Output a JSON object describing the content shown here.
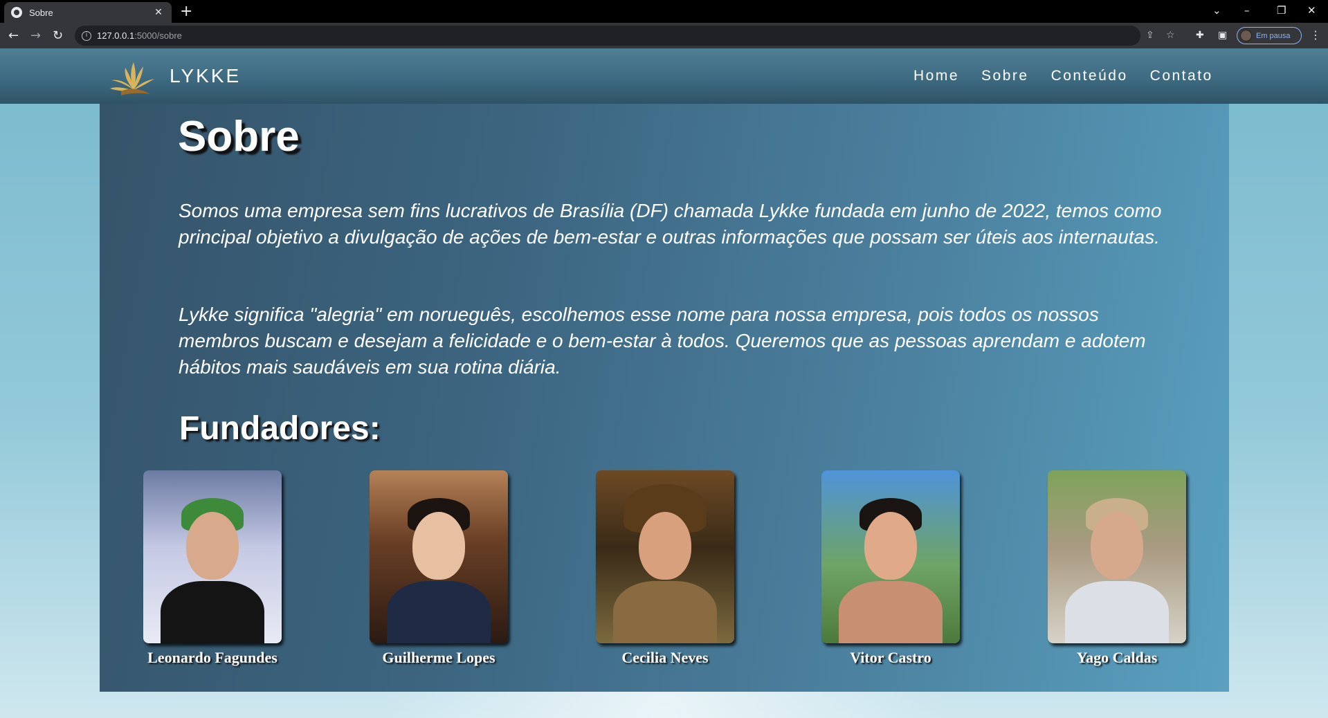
{
  "browser": {
    "tab_title": "Sobre",
    "tab_close": "✕",
    "new_tab": "+",
    "url_host": "127.0.0.1",
    "url_path": ":5000/sobre",
    "profile_label": "Em pausa",
    "window_controls": {
      "dropdown": "⌄",
      "minimize": "–",
      "restore": "❐",
      "close": "✕"
    }
  },
  "site": {
    "brand": "LYKKE",
    "nav": [
      "Home",
      "Sobre",
      "Conteúdo",
      "Contato"
    ]
  },
  "page": {
    "title": "Sobre",
    "paragraphs": [
      "Somos uma empresa sem fins lucrativos de Brasília (DF) chamada Lykke fundada em junho de 2022, temos como principal objetivo a divulgação de ações de bem-estar e outras informações que possam ser úteis aos internautas.",
      "Lykke significa \"alegria\" em norueguês, escolhemos esse nome para nossa empresa, pois todos os nossos membros buscam e desejam a felicidade e o bem-estar à todos. Queremos que as pessoas aprendam e adotem hábitos mais saudáveis em sua rotina diária."
    ],
    "founders_heading": "Fundadores:",
    "founders": [
      {
        "name": "Leonardo Fagundes"
      },
      {
        "name": "Guilherme Lopes"
      },
      {
        "name": "Cecilia Neves"
      },
      {
        "name": "Vitor Castro"
      },
      {
        "name": "Yago Caldas"
      }
    ]
  },
  "colors": {
    "header_bg": "#3e6b82",
    "content_bg_left": "#35546a",
    "content_bg_right": "#5aa0c0",
    "page_bg": "#8fc5d6",
    "text": "#ffffff",
    "logo_gold": "#c9a24a"
  },
  "icons": {
    "back": "back-arrow-icon",
    "forward": "forward-arrow-icon",
    "reload": "reload-icon",
    "site_info": "info-icon",
    "share": "share-icon",
    "bookmark": "star-icon",
    "extensions": "puzzle-icon",
    "side_panel": "side-panel-icon",
    "menu": "kebab-menu-icon"
  }
}
